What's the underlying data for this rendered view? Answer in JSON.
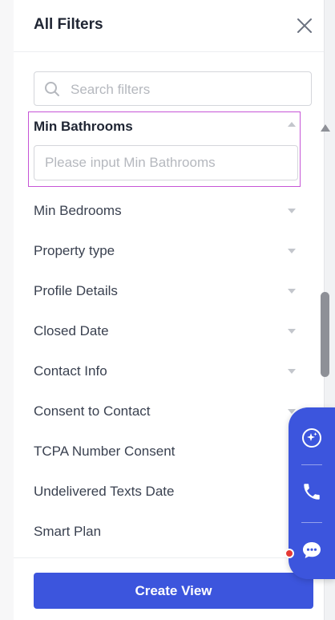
{
  "panel": {
    "title": "All Filters",
    "close_icon": "close-icon"
  },
  "search": {
    "placeholder": "Search filters",
    "value": "",
    "icon": "search-icon"
  },
  "expanded_filter": {
    "label": "Min Bathrooms",
    "input_placeholder": "Please input Min Bathrooms",
    "input_value": ""
  },
  "filters": [
    {
      "label": "Min Bedrooms",
      "has_caret": true
    },
    {
      "label": "Property type",
      "has_caret": true
    },
    {
      "label": "Profile Details",
      "has_caret": true
    },
    {
      "label": "Closed Date",
      "has_caret": true
    },
    {
      "label": "Contact Info",
      "has_caret": true
    },
    {
      "label": "Consent to Contact",
      "has_caret": true
    },
    {
      "label": "TCPA Number Consent",
      "has_caret": false
    },
    {
      "label": "Undelivered Texts Date",
      "has_caret": false
    },
    {
      "label": "Smart Plan",
      "has_caret": false
    }
  ],
  "footer": {
    "create_label": "Create View"
  },
  "dock": {
    "buttons": [
      "assistant-icon",
      "phone-icon",
      "chat-icon"
    ],
    "notification_dot": true
  },
  "colors": {
    "primary": "#3c55dd",
    "highlight_border": "#c655d6",
    "notification": "#e53935"
  }
}
